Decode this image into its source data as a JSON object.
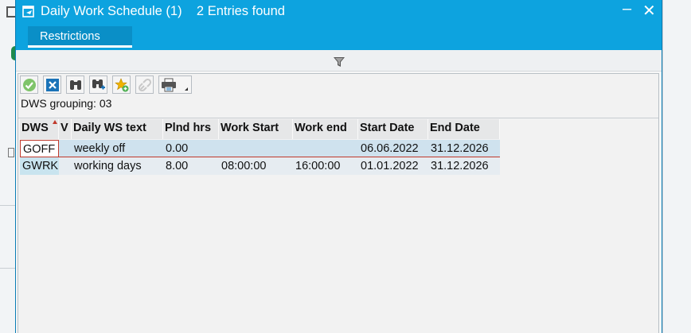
{
  "dialog": {
    "title": "Daily Work Schedule (1)    2 Entries found",
    "minimize_label": "–",
    "close_label": "✕"
  },
  "tabs": [
    {
      "label": "Restrictions"
    }
  ],
  "toolbar": {
    "buttons": [
      "ok-icon",
      "cancel-icon",
      "find-icon",
      "find-next-icon",
      "add-favorite-icon",
      "link-icon",
      "print-icon"
    ]
  },
  "grouping": {
    "text": "DWS grouping: 03"
  },
  "table": {
    "columns": [
      "DWS",
      "V",
      "Daily WS text",
      "Plnd hrs",
      "Work Start",
      "Work end",
      "Start Date",
      "End Date"
    ],
    "rows": [
      [
        "GOFF",
        "",
        "weekly off",
        "0.00",
        "",
        "",
        "06.06.2022",
        "31.12.2026"
      ],
      [
        "GWRK",
        "",
        "working days",
        "8.00",
        "08:00:00",
        "16:00:00",
        "01.01.2022",
        "31.12.2026"
      ]
    ]
  },
  "colors": {
    "title_bar": "#0da3df",
    "tab_active": "#0a8fc7",
    "selection_border": "#c0392b",
    "row_selected": "#cfe2ee"
  }
}
